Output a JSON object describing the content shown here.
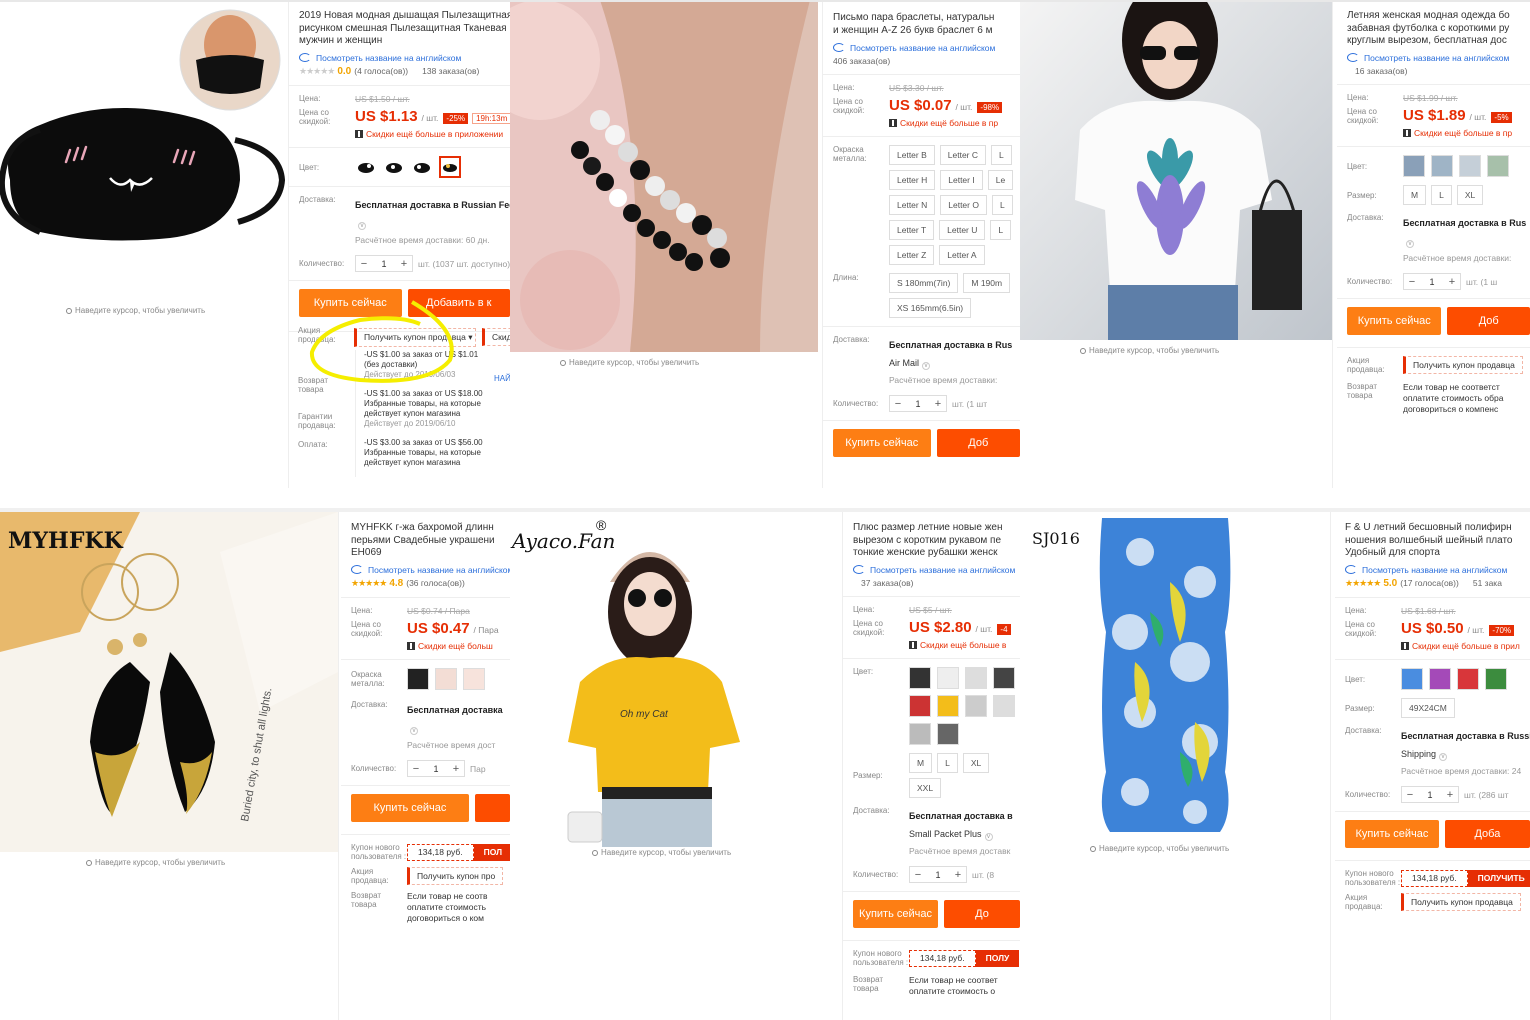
{
  "common": {
    "zoom_hint": "Наведите курсор, чтобы увеличить",
    "translate_link": "Посмотреть название на английском",
    "lbl_price": "Цена:",
    "lbl_disc_price": "Цена со скидкой:",
    "lbl_color": "Цвет:",
    "lbl_size": "Размер:",
    "lbl_delivery": "Доставка:",
    "lbl_qty": "Количество:",
    "lbl_metal": "Окраска металла:",
    "lbl_length": "Длина:",
    "lbl_promo": "Акция продавца:",
    "lbl_return": "Возврат товара",
    "lbl_guarantee": "Гарантии продавца:",
    "lbl_payment": "Оплата:",
    "lbl_new_coupon": "Купон нового пользователя :",
    "buy_now": "Купить сейчас",
    "app_note": "Скидки ещё больше в приложении",
    "est_delivery": "Расчётное время доставки:",
    "get_coupon": "Получить купон продавца",
    "return_text": "Если товар не соответствует описанию, верните его или оплатите стоимость обратной доставки договориться о компенсации",
    "minus": "−",
    "plus": "+",
    "mag": "Q"
  },
  "p1": {
    "title": "2019 Новая модная дышащая Пылезащитная\nрисунком смешная Пылезащитная Тканевая\nмужчин и женщин",
    "rating": "0.0",
    "votes": "(4 голоса(ов))",
    "orders": "138 заказа(ов)",
    "old_price": "US $1.50 / шт.",
    "price": "US $1.13",
    "unit": "/ шт.",
    "discount": "-25%",
    "timer": "19h:13m",
    "delivery": "Бесплатная доставка в Russian Federat",
    "est": "Расчётное время доставки: 60 дн.",
    "qty": "1",
    "qty_avail": "шт. (1037 шт. доступно)",
    "cart_btn": "Добавить в к",
    "coupon_btn": "Получить купон продавца",
    "coupon_side": "Скид",
    "coupons": [
      {
        "text": "-US $1.00 за заказ от US $1.01 (без доставки)",
        "date": "Действует до 2019/06/03"
      },
      {
        "text": "-US $1.00 за заказ от US $18.00 Избранные товары, на которые действует купон магазина",
        "date": "Действует до 2019/06/10"
      },
      {
        "text": "-US $3.00 за заказ от US $56.00 Избранные товары, на которые действует купон магазина",
        "date": ""
      }
    ],
    "find_link": "НАЙ"
  },
  "p2": {
    "title": "Письмо пара браслеты, натуральн\nи женщин A-Z 26 букв браслет 6 м",
    "orders": "406 заказа(ов)",
    "old_price": "US $3.30 / шт.",
    "price": "US $0.07",
    "unit": "/ шт.",
    "discount": "-98%",
    "app_note": "Скидки ещё больше в пр",
    "letters": [
      "Letter B",
      "Letter C",
      "L",
      "Letter H",
      "Letter I",
      "Le",
      "Letter N",
      "Letter O",
      "L",
      "Letter T",
      "Letter U",
      "L",
      "Letter Z",
      "Letter A"
    ],
    "lengths": [
      "S 180mm(7in)",
      "M 190m",
      "XS 165mm(6.5in)"
    ],
    "delivery": "Бесплатная доставка в Rus",
    "delivery2": "Air Mail",
    "est": "Расчётное время доставки:",
    "qty": "1",
    "qty_avail": "шт. (1 шт",
    "cart_btn": "Доб"
  },
  "p3": {
    "title": "Летняя женская модная одежда бо\nзабавная футболка с короткими ру\nкруглым вырезом, бесплатная дос",
    "orders": "16 заказа(ов)",
    "old_price": "US $1.99 / шт.",
    "price": "US $1.89",
    "unit": "/ шт.",
    "discount": "-5%",
    "app_note": "Скидки ещё больше в пр",
    "sizes": [
      "M",
      "L",
      "XL"
    ],
    "delivery": "Бесплатная доставка в Rus",
    "est": "Расчётное время доставки:",
    "qty": "1",
    "qty_avail": "шт. (1 ш",
    "cart_btn": "Доб",
    "return_text": "Если товар не соответст оплатите стоимость обра договориться о компенс"
  },
  "p4": {
    "brand": "MYHFKK",
    "title": "MYHFKK г-жа бахромой длинн\nперьями Свадебные украшени\nEH069",
    "rating": "4.8",
    "votes": "(36 голоса(ов))",
    "old_price": "US $0.74 / Пара",
    "price": "US $0.47",
    "unit": "/ Пара",
    "app_note": "Скидки ещё больш",
    "delivery": "Бесплатная доставка",
    "est": "Расчётное время дост",
    "qty": "1",
    "qty_avail": "Пар",
    "coupon_amt": "134,18 руб.",
    "coupon_get": "ПОЛ",
    "coupon_btn": "Получить купон про",
    "return_text": "Если товар не соотв оплатите стоимость договориться о ком",
    "art_text": "Buried city, to shut all lights."
  },
  "p5": {
    "brand": "Ayaco.Fan",
    "reg": "®",
    "shirt_text": "Oh my Cat",
    "title": "Плюс размер летние новые жен\nвырезом с коротким рукавом пе\nтонкие женские рубашки женск",
    "orders": "37 заказа(ов)",
    "old_price": "US $5 / шт.",
    "price": "US $2.80",
    "unit": "/ шт.",
    "discount": "-4",
    "app_note": "Скидки ещё больше в",
    "sizes": [
      "M",
      "L",
      "XL",
      "XXL"
    ],
    "delivery": "Бесплатная доставка в",
    "delivery2": "Small Packet Plus",
    "est": "Расчётное время доставк",
    "qty": "1",
    "qty_avail": "шт. (8",
    "cart_btn": "До",
    "coupon_amt": "134,18 руб.",
    "coupon_get": "ПОЛУ",
    "return_text": "Если товар не соответ оплатите стоимость о"
  },
  "p6": {
    "brand": "SJ016",
    "title": "F & U летний бесшовный полифирн\nношения волшебный шейный плато\nУдобный для спорта",
    "rating": "5.0",
    "votes": "(17 голоса(ов))",
    "orders": "51 зака",
    "old_price": "US $1.68 / шт.",
    "price": "US $0.50",
    "unit": "/ шт.",
    "discount": "-70%",
    "app_note": "Скидки ещё больше в прил",
    "size": "49X24CM",
    "delivery": "Бесплатная доставка в Russi",
    "delivery2": "Shipping",
    "est": "Расчётное время доставки: 24",
    "qty": "1",
    "qty_avail": "шт. (286 шт",
    "cart_btn": "Доба",
    "coupon_amt": "134,18 руб.",
    "coupon_get": "ПОЛУЧИТЬ",
    "coupon_btn": "Получить купон продавца"
  },
  "colors": {
    "orange": "#fd7e14",
    "red": "#e62e04",
    "highlight": "#f5ee00",
    "link": "#2c6fdb"
  }
}
